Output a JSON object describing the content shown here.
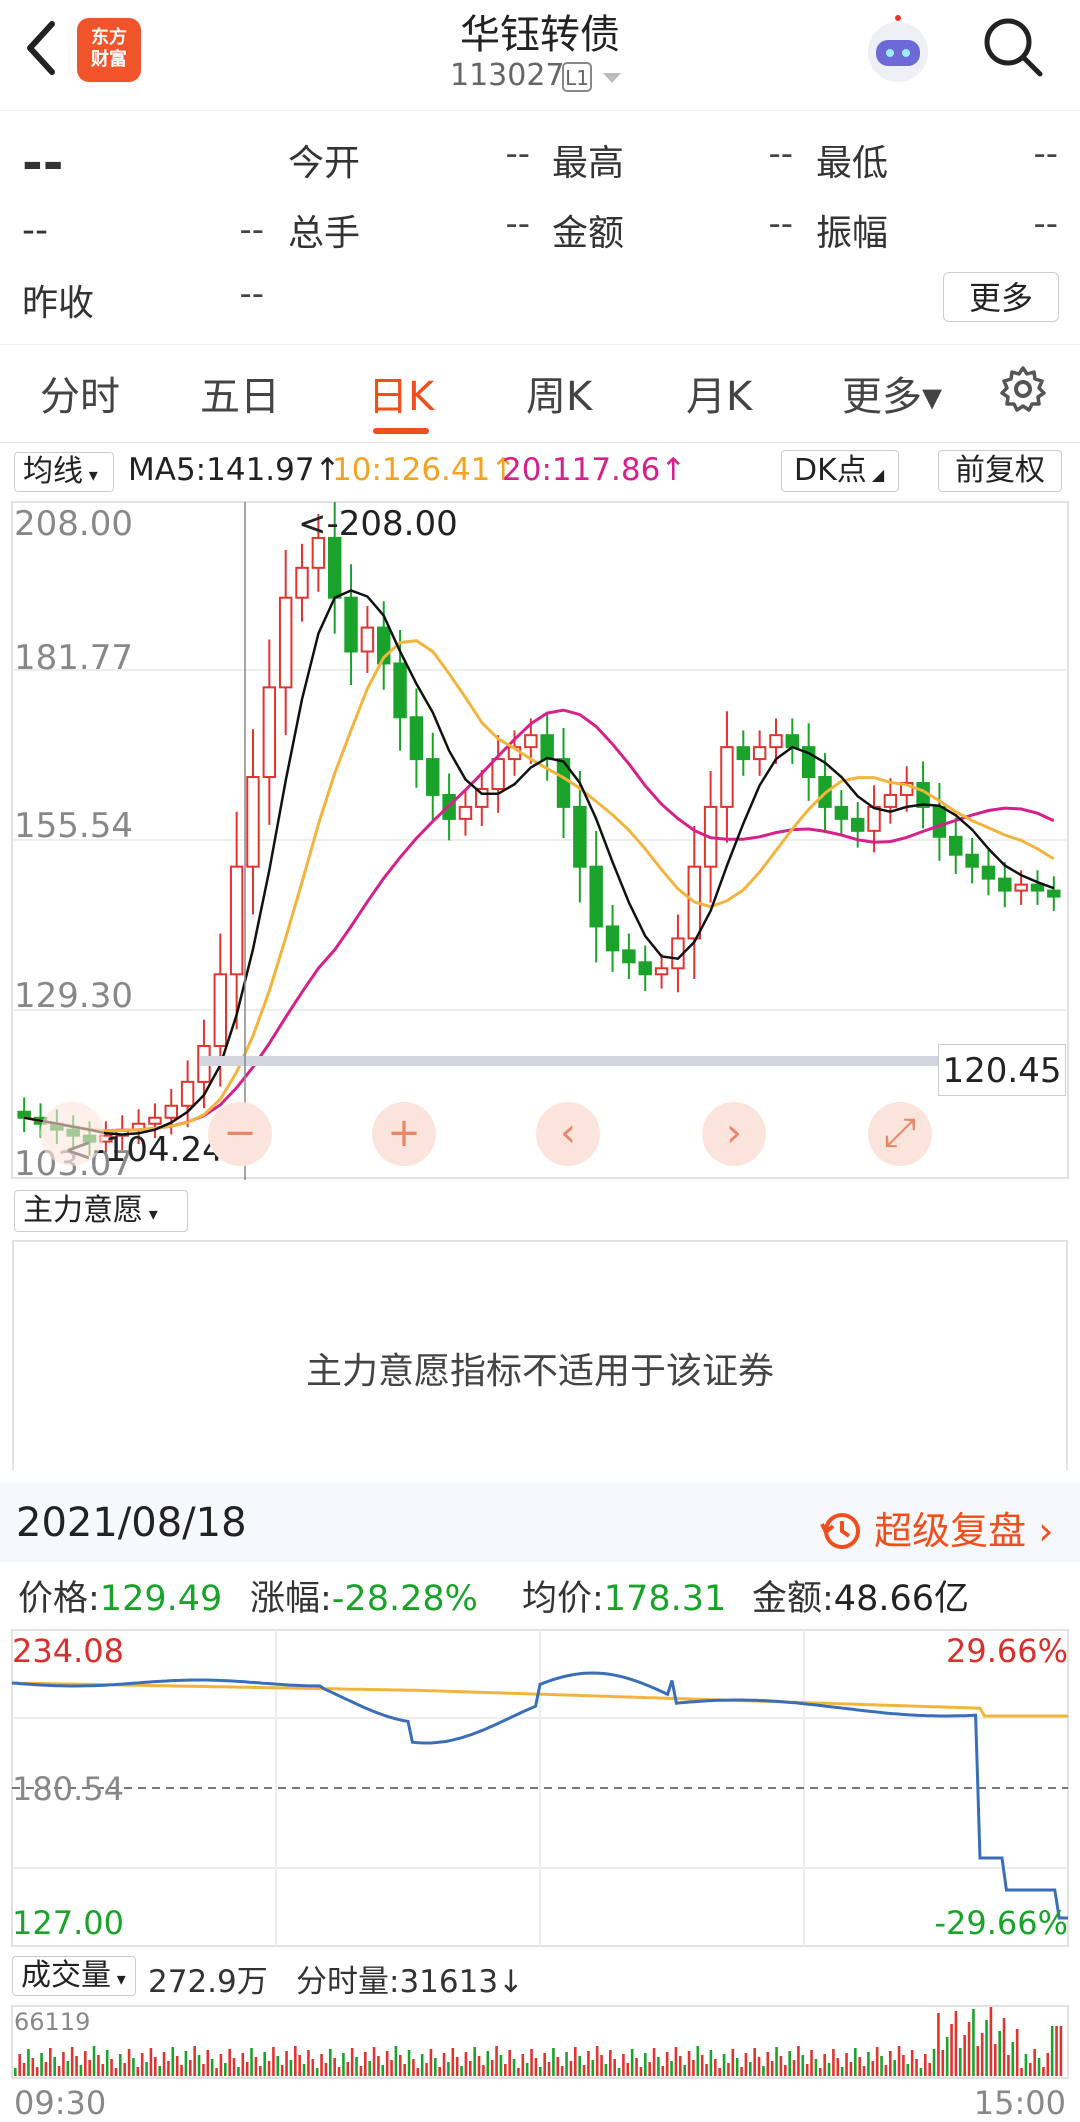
{
  "header": {
    "title": "华钰转债",
    "code": "113027",
    "level": "L1",
    "logo_line1": "东方",
    "logo_line2": "财富"
  },
  "quote": {
    "last": "--",
    "change": "--",
    "change_pct": "--",
    "open_label": "今开",
    "open": "--",
    "high_label": "最高",
    "high": "--",
    "low_label": "最低",
    "low": "--",
    "volume_label": "总手",
    "volume": "--",
    "amount_label": "金额",
    "amount": "--",
    "amplitude_label": "振幅",
    "amplitude": "--",
    "prev_close_label": "昨收",
    "prev_close": "--",
    "more_label": "更多"
  },
  "tabs": [
    {
      "label": "分时"
    },
    {
      "label": "五日"
    },
    {
      "label": "日K"
    },
    {
      "label": "周K"
    },
    {
      "label": "月K"
    },
    {
      "label": "更多▾"
    }
  ],
  "active_tab": "日K",
  "ma_bar": {
    "dropdown": "均线",
    "ma5": "MA5:141.97↑",
    "ma10": "10:126.41↑",
    "ma20": "20:117.86↑",
    "dk": "DK点",
    "adjust": "前复权"
  },
  "colors": {
    "up": "#e0342f",
    "down": "#1aa32a",
    "ma5": "#111111",
    "ma10": "#f2b43c",
    "ma20": "#d6218a",
    "accent": "#f04f1c"
  },
  "kline": {
    "y_labels": [
      "208.00",
      "181.77",
      "155.54",
      "129.30",
      "103.07"
    ],
    "max_marker": "<-208.00",
    "min_marker": "<-104.24",
    "current_line": "120.45"
  },
  "nav_buttons": [
    "−",
    "+",
    "‹",
    "›",
    "⤢"
  ],
  "indicator": {
    "dropdown": "主力意愿",
    "message": "主力意愿指标不适用于该证券"
  },
  "day": {
    "date": "2021/08/18",
    "replay": "超级复盘",
    "price_label": "价格:",
    "price": "129.49",
    "change_label": "涨幅:",
    "change": "-28.28%",
    "avg_label": "均价:",
    "avg": "178.31",
    "amount_label": "金额:",
    "amount": "48.66亿"
  },
  "intraday": {
    "max": "234.08",
    "mid": "180.54",
    "min": "127.00",
    "max_pct": "29.66%",
    "min_pct": "-29.66%"
  },
  "volume": {
    "dropdown": "成交量",
    "total": "272.9万",
    "tick_label": "分时量:31613↓",
    "max": "66119",
    "start_time": "09:30",
    "end_time": "15:00"
  }
}
